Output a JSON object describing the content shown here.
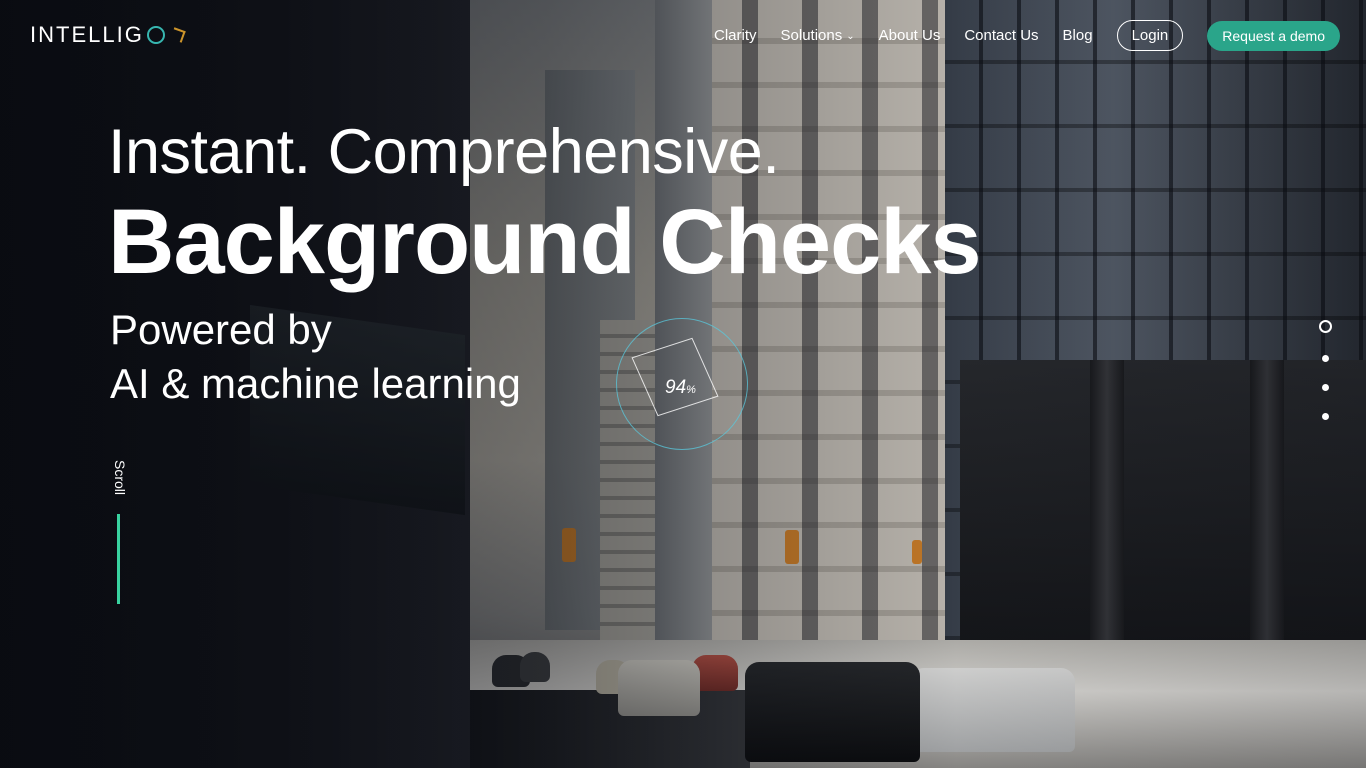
{
  "header": {
    "logo_text": "INTELLIG",
    "nav": {
      "clarity": "Clarity",
      "solutions": "Solutions",
      "about": "About Us",
      "contact": "Contact Us",
      "blog": "Blog",
      "login": "Login",
      "demo": "Request a demo"
    }
  },
  "hero": {
    "line1": "Instant. Comprehensive.",
    "line2": "Background Checks",
    "line3": "Powered by",
    "line4": "AI & machine learning",
    "badge_value": "94",
    "badge_unit": "%"
  },
  "scroll_label": "Scroll",
  "slider": {
    "count": 4,
    "active_index": 0
  },
  "colors": {
    "accent": "#2aa58a",
    "scroll_line": "#39d3a0",
    "logo_ring": "#37b6b0"
  }
}
